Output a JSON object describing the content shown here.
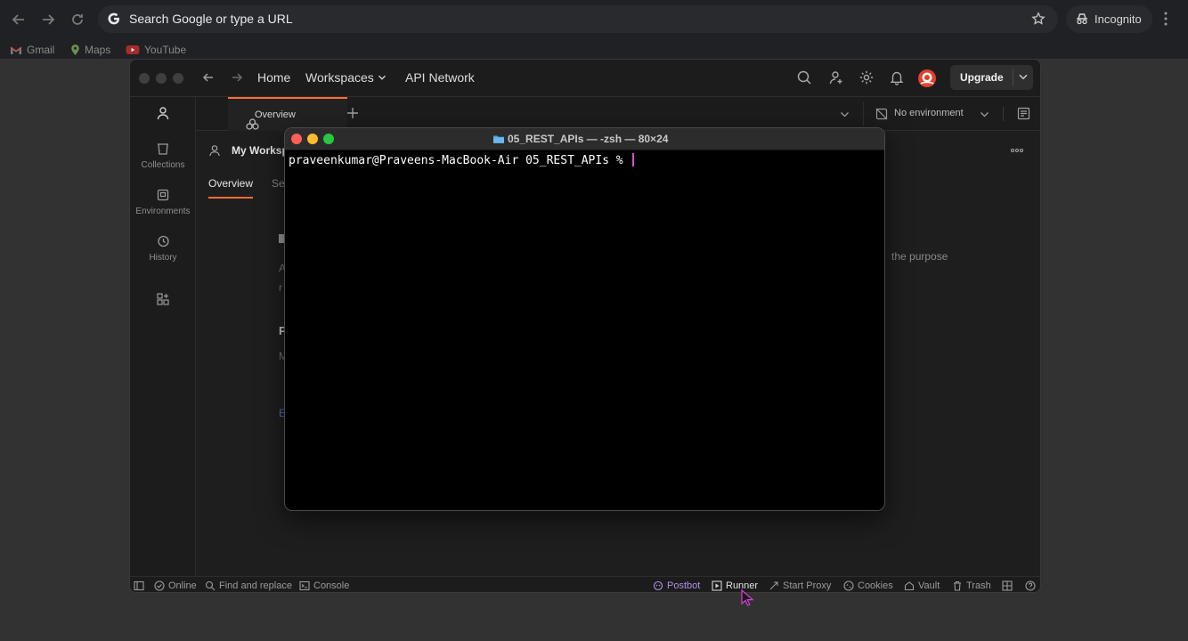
{
  "browser": {
    "omnibox_placeholder": "Search Google or type a URL",
    "incognito_label": "Incognito",
    "bookmarks": [
      {
        "label": "Gmail",
        "icon": "gmail-icon"
      },
      {
        "label": "Maps",
        "icon": "maps-icon"
      },
      {
        "label": "YouTube",
        "icon": "youtube-icon"
      }
    ]
  },
  "postman": {
    "nav": {
      "home": "Home",
      "workspaces": "Workspaces",
      "api_network": "API Network"
    },
    "upgrade_label": "Upgrade",
    "sidebar": [
      {
        "label": "",
        "icon": "user-icon"
      },
      {
        "label": "Collections",
        "icon": "collections-icon"
      },
      {
        "label": "Environments",
        "icon": "environments-icon"
      },
      {
        "label": "History",
        "icon": "history-icon"
      },
      {
        "label": "",
        "icon": "add-apps-icon"
      }
    ],
    "tab_label": "Overview",
    "environment_label": "No environment",
    "workspace_title": "My Worksp",
    "workspace_tabs": {
      "overview": "Overview",
      "settings": "Se"
    },
    "ghost_text": {
      "purpose": "the purpose",
      "p": "P",
      "a": "A",
      "r": "r",
      "m": "M",
      "e": "E"
    },
    "footer": {
      "online": "Online",
      "find_replace": "Find and replace",
      "console": "Console",
      "postbot": "Postbot",
      "runner": "Runner",
      "start_proxy": "Start Proxy",
      "cookies": "Cookies",
      "vault": "Vault",
      "trash": "Trash"
    },
    "colors": {
      "accent": "#ff6c37",
      "postbot": "#b28fe8"
    }
  },
  "terminal": {
    "title": "05_REST_APIs — -zsh — 80×24",
    "prompt": "praveenkumar@Praveens-MacBook-Air 05_REST_APIs % "
  }
}
